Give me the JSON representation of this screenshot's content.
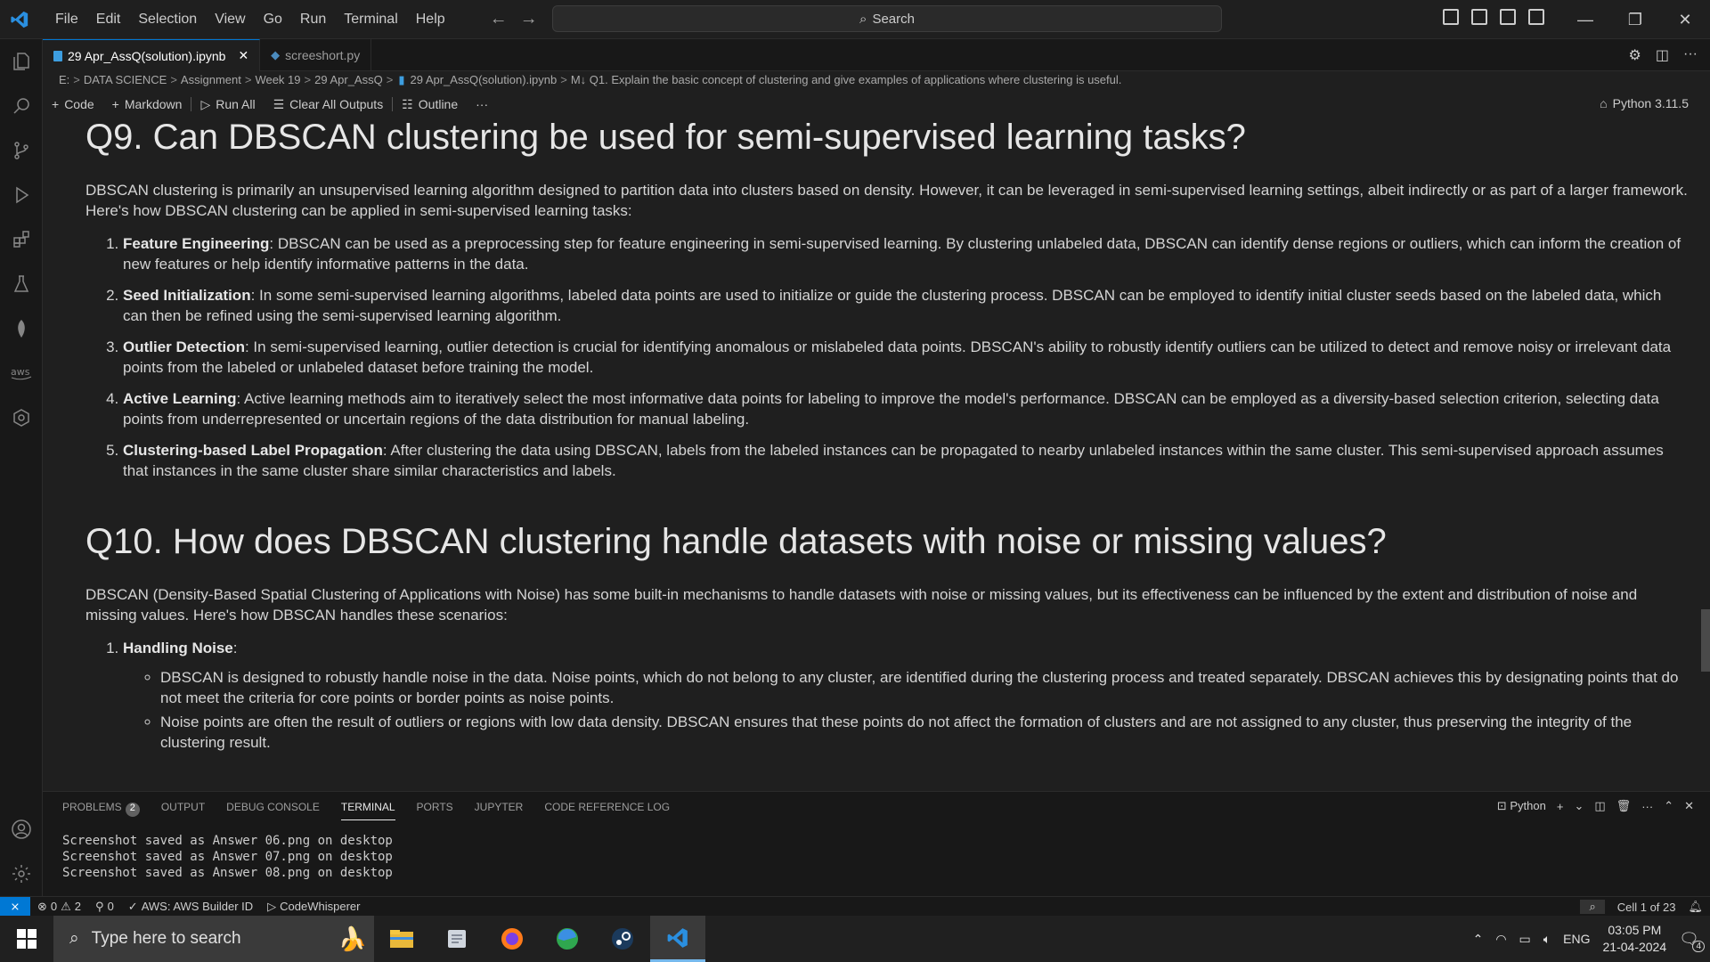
{
  "menu": [
    "File",
    "Edit",
    "Selection",
    "View",
    "Go",
    "Run",
    "Terminal",
    "Help"
  ],
  "search": {
    "label": "Search"
  },
  "tabs": [
    {
      "label": "29 Apr_AssQ(solution).ipynb",
      "active": true
    },
    {
      "label": "screeshort.py",
      "active": false
    }
  ],
  "breadcrumb": [
    "E:",
    "DATA SCIENCE",
    "Assignment",
    "Week 19",
    "29 Apr_AssQ",
    "29 Apr_AssQ(solution).ipynb",
    "M↓ Q1. Explain the basic concept of clustering and give examples of applications where clustering is useful."
  ],
  "toolbar": {
    "code": "Code",
    "markdown": "Markdown",
    "run_all": "Run All",
    "clear_all": "Clear All Outputs",
    "outline": "Outline",
    "more": "···",
    "kernel": "Python 3.11.5"
  },
  "content": {
    "q9": {
      "heading": "Q9. Can DBSCAN clustering be used for semi-supervised learning tasks?",
      "intro": "DBSCAN clustering is primarily an unsupervised learning algorithm designed to partition data into clusters based on density. However, it can be leveraged in semi-supervised learning settings, albeit indirectly or as part of a larger framework. Here's how DBSCAN clustering can be applied in semi-supervised learning tasks:",
      "items": [
        {
          "title": "Feature Engineering",
          "text": ": DBSCAN can be used as a preprocessing step for feature engineering in semi-supervised learning. By clustering unlabeled data, DBSCAN can identify dense regions or outliers, which can inform the creation of new features or help identify informative patterns in the data."
        },
        {
          "title": "Seed Initialization",
          "text": ": In some semi-supervised learning algorithms, labeled data points are used to initialize or guide the clustering process. DBSCAN can be employed to identify initial cluster seeds based on the labeled data, which can then be refined using the semi-supervised learning algorithm."
        },
        {
          "title": "Outlier Detection",
          "text": ": In semi-supervised learning, outlier detection is crucial for identifying anomalous or mislabeled data points. DBSCAN's ability to robustly identify outliers can be utilized to detect and remove noisy or irrelevant data points from the labeled or unlabeled dataset before training the model."
        },
        {
          "title": "Active Learning",
          "text": ": Active learning methods aim to iteratively select the most informative data points for labeling to improve the model's performance. DBSCAN can be employed as a diversity-based selection criterion, selecting data points from underrepresented or uncertain regions of the data distribution for manual labeling."
        },
        {
          "title": "Clustering-based Label Propagation",
          "text": ": After clustering the data using DBSCAN, labels from the labeled instances can be propagated to nearby unlabeled instances within the same cluster. This semi-supervised approach assumes that instances in the same cluster share similar characteristics and labels."
        }
      ]
    },
    "q10": {
      "heading": "Q10. How does DBSCAN clustering handle datasets with noise or missing values?",
      "intro": "DBSCAN (Density-Based Spatial Clustering of Applications with Noise) has some built-in mechanisms to handle datasets with noise or missing values, but its effectiveness can be influenced by the extent and distribution of noise and missing values. Here's how DBSCAN handles these scenarios:",
      "item1_title": "Handling Noise",
      "item1_suffix": ":",
      "bullets": [
        "DBSCAN is designed to robustly handle noise in the data. Noise points, which do not belong to any cluster, are identified during the clustering process and treated separately. DBSCAN achieves this by designating points that do not meet the criteria for core points or border points as noise points.",
        "Noise points are often the result of outliers or regions with low data density. DBSCAN ensures that these points do not affect the formation of clusters and are not assigned to any cluster, thus preserving the integrity of the clustering result."
      ]
    }
  },
  "panel": {
    "tabs": [
      "PROBLEMS",
      "OUTPUT",
      "DEBUG CONSOLE",
      "TERMINAL",
      "PORTS",
      "JUPYTER",
      "CODE REFERENCE LOG"
    ],
    "problems_count": "2",
    "active_tab": "TERMINAL",
    "terminal_profile": "Python",
    "terminal_lines": [
      "Screenshot saved as Answer 06.png on desktop",
      "Screenshot saved as Answer 07.png on desktop",
      "Screenshot saved as Answer 08.png on desktop"
    ]
  },
  "statusbar": {
    "errors": "0",
    "warnings": "2",
    "ports": "0",
    "aws": "AWS: AWS Builder ID",
    "codewhisperer": "CodeWhisperer",
    "cell": "Cell 1 of 23"
  },
  "taskbar": {
    "search_placeholder": "Type here to search",
    "lang": "ENG",
    "time": "03:05 PM",
    "date": "21-04-2024",
    "notifications": "4"
  },
  "colors": {
    "accent": "#0078d4",
    "background": "#1f1f1f"
  }
}
